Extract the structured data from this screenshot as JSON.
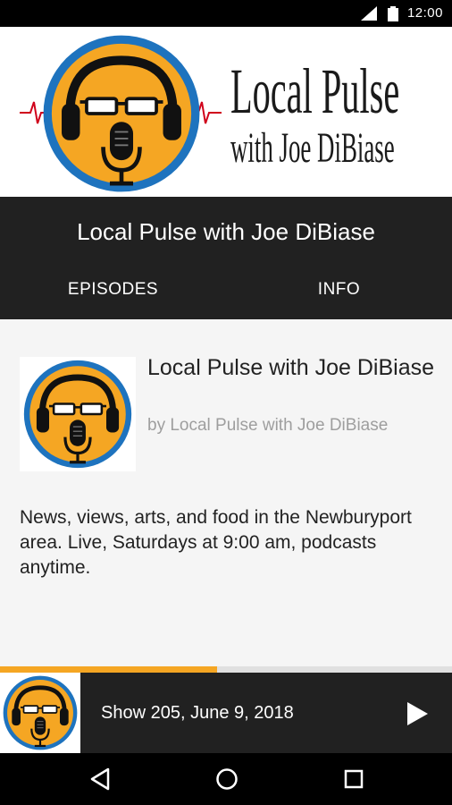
{
  "status_bar": {
    "time": "12:00"
  },
  "banner": {
    "brand_line1": "Local Pulse",
    "brand_line2": "with Joe DiBiase"
  },
  "header": {
    "title": "Local Pulse with Joe DiBiase",
    "tabs": [
      {
        "label": "EPISODES"
      },
      {
        "label": "INFO"
      }
    ],
    "selected_tab": "INFO"
  },
  "info": {
    "title": "Local Pulse with Joe DiBiase",
    "author": "by Local Pulse with Joe DiBiase",
    "description": "News, views, arts, and food in the Newburyport area. Live, Saturdays at 9:00 am, podcasts anytime."
  },
  "player": {
    "episode_title": "Show 205, June 9, 2018",
    "progress": 0.48
  },
  "colors": {
    "accent": "#f5a623",
    "header_bg": "#212121",
    "logo_ring": "#1e73be",
    "logo_fill": "#f5a623"
  },
  "icons": {
    "signal": "signal-icon",
    "battery": "battery-icon",
    "play": "play-icon",
    "back": "back-icon",
    "home": "home-icon",
    "recents": "recents-icon"
  }
}
